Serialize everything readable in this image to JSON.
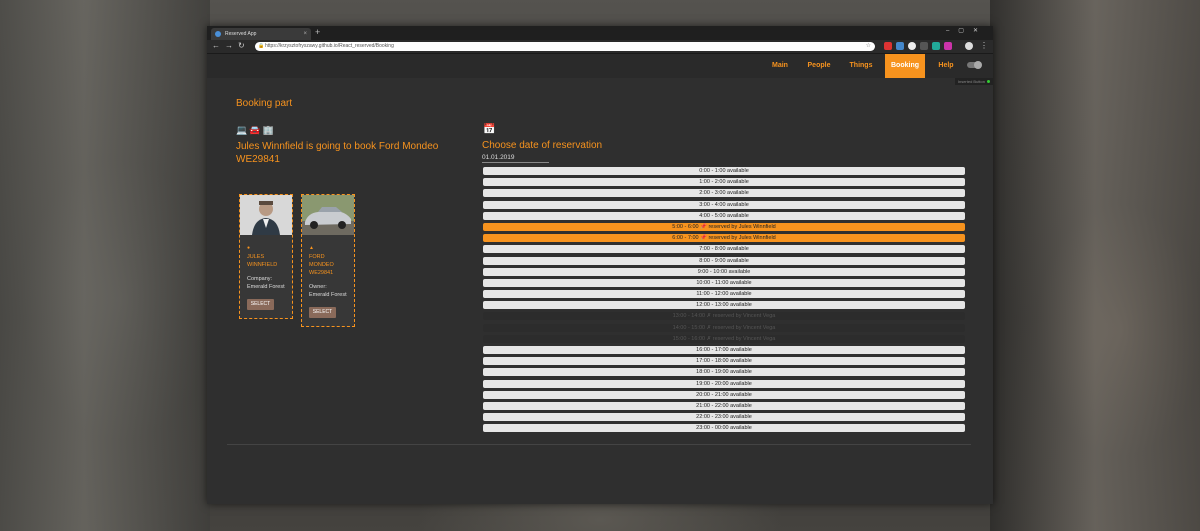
{
  "browser": {
    "tab_title": "Reserved App",
    "tab_close": "×",
    "new_tab": "+",
    "window_controls": "–▢✕",
    "url": "https://krzysztofryszawy.github.io/React_reserved/Booking"
  },
  "appnav": {
    "items": [
      "Main",
      "People",
      "Things",
      "Booking",
      "Help"
    ],
    "toggle_label": "Inserted Button"
  },
  "page": {
    "section_title": "Booking part",
    "heading": "Jules Winnfield is going to book Ford Mondeo WE29841",
    "choose_title": "Choose date of reservation",
    "date_value": "01.01.2019"
  },
  "cards": [
    {
      "name_line1": "JULES",
      "name_line2": "WINNFIELD",
      "info_line1": "Company:",
      "info_line2": "Emerald Forest",
      "button": "SELECT"
    },
    {
      "name_line1": "FORD",
      "name_line2": "MONDEO",
      "name_line3": "WE29841",
      "info_line1": "Owner:",
      "info_line2": "Emerald Forest",
      "button": "SELECT"
    }
  ],
  "slots": [
    {
      "text": "0:00 - 1:00 available",
      "state": "free"
    },
    {
      "text": "1:00 - 2:00 available",
      "state": "free"
    },
    {
      "text": "2:00 - 3:00 available",
      "state": "free"
    },
    {
      "text": "3:00 - 4:00 available",
      "state": "free"
    },
    {
      "text": "4:00 - 5:00 available",
      "state": "free"
    },
    {
      "text": "5:00 - 6:00 📌 reserved by Jules Winnfield",
      "state": "mine"
    },
    {
      "text": "6:00 - 7:00 📌 reserved by Jules Winnfield",
      "state": "mine"
    },
    {
      "text": "7:00 - 8:00 available",
      "state": "free"
    },
    {
      "text": "8:00 - 9:00 available",
      "state": "free"
    },
    {
      "text": "9:00 - 10:00 available",
      "state": "free"
    },
    {
      "text": "10:00 - 11:00 available",
      "state": "free"
    },
    {
      "text": "11:00 - 12:00 available",
      "state": "free"
    },
    {
      "text": "12:00 - 13:00 available",
      "state": "free"
    },
    {
      "text": "13:00 - 14:00 ✗ reserved by Vincent Vega",
      "state": "other"
    },
    {
      "text": "14:00 - 15:00 ✗ reserved by Vincent Vega",
      "state": "other"
    },
    {
      "text": "15:00 - 16:00 ✗ reserved by Vincent Vega",
      "state": "other"
    },
    {
      "text": "16:00 - 17:00 available",
      "state": "free"
    },
    {
      "text": "17:00 - 18:00 available",
      "state": "free"
    },
    {
      "text": "18:00 - 19:00 available",
      "state": "free"
    },
    {
      "text": "19:00 - 20:00 available",
      "state": "free"
    },
    {
      "text": "20:00 - 21:00 available",
      "state": "free"
    },
    {
      "text": "21:00 - 22:00 available",
      "state": "free"
    },
    {
      "text": "22:00 - 23:00 available",
      "state": "free"
    },
    {
      "text": "23:00 - 00:00 available",
      "state": "free"
    }
  ],
  "colors": {
    "accent": "#f7931e",
    "panel": "#2f2f2f",
    "slot_free": "#e6e6e6",
    "slot_other": "#2c2c2c"
  },
  "icons": [
    "laptop-icon",
    "car-icon",
    "building-icon",
    "calendar-icon",
    "user-icon",
    "car-small-icon"
  ]
}
